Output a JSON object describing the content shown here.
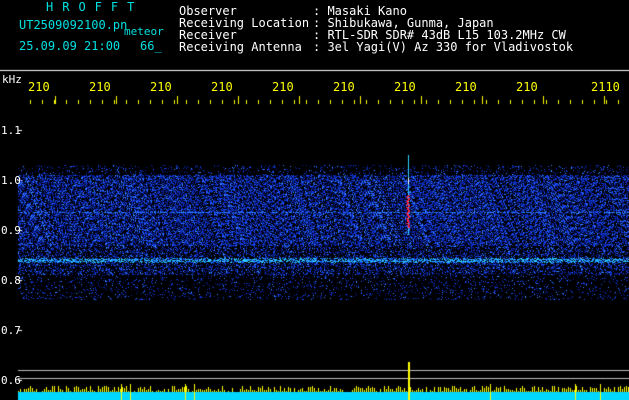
{
  "header": {
    "brand": "HROFFT",
    "file_name": "UT2509092100.pn",
    "type_tag": "meteor",
    "datetime": "25.09.09 21:00",
    "count": "66_"
  },
  "station_info": [
    {
      "label": "Observer",
      "value": ": Masaki Kano"
    },
    {
      "label": "Receiving Location",
      "value": ": Shibukawa, Gunma, Japan"
    },
    {
      "label": "Receiver",
      "value": ": RTL-SDR SDR# 43dB L15 103.2MHz CW"
    },
    {
      "label": "Receiving Antenna",
      "value": ": 3el Yagi(V) Az 330 for Vladivostok"
    }
  ],
  "axis": {
    "unit": "kHz",
    "x_ticks": [
      "210",
      "210",
      "210",
      "210",
      "210",
      "210",
      "210",
      "210",
      "210",
      "2110"
    ],
    "y_ticks": [
      "1.1",
      "1.0",
      "0.9",
      "0.8",
      "0.7",
      "0.6"
    ]
  },
  "colors": {
    "text_cyan": "#00e0e0",
    "tick_yellow": "#ffff00",
    "noise_blue": "#0a3cff",
    "band_cyan": "#30d0ff",
    "meteor_red": "#ff2040",
    "level_cyan": "#00d8ff"
  }
}
